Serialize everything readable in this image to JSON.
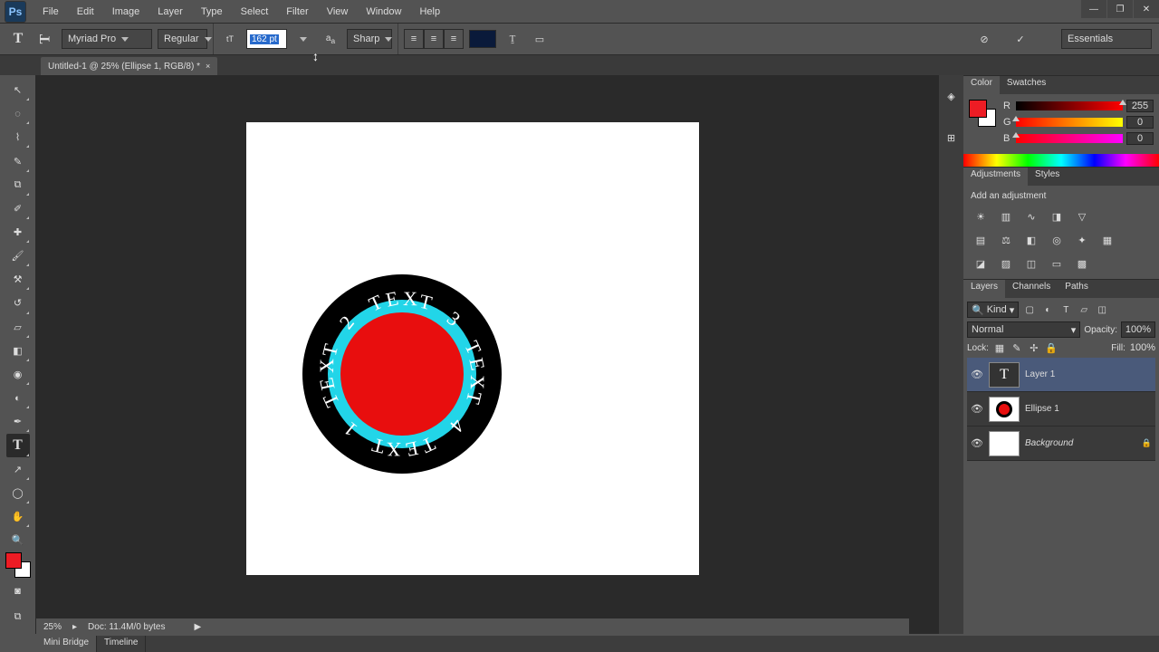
{
  "menu": [
    "File",
    "Edit",
    "Image",
    "Layer",
    "Type",
    "Select",
    "Filter",
    "View",
    "Window",
    "Help"
  ],
  "options": {
    "font": "Myriad Pro",
    "font_style": "Regular",
    "size": "162 pt",
    "aa": "Sharp",
    "workspace": "Essentials"
  },
  "tab": {
    "title": "Untitled-1 @ 25% (Ellipse 1, RGB/8) *"
  },
  "color_panel": {
    "tabs": [
      "Color",
      "Swatches"
    ],
    "r": 255,
    "g": 0,
    "b": 0
  },
  "adjustments_panel": {
    "tabs": [
      "Adjustments",
      "Styles"
    ],
    "label": "Add an adjustment"
  },
  "layers_panel": {
    "tabs": [
      "Layers",
      "Channels",
      "Paths"
    ],
    "kind": "Kind",
    "blend": "Normal",
    "opacity_label": "Opacity:",
    "opacity": "100%",
    "lock_label": "Lock:",
    "fill_label": "Fill:",
    "fill": "100%",
    "layers": [
      {
        "name": "Layer 1",
        "type": "text",
        "selected": true
      },
      {
        "name": "Ellipse 1",
        "type": "ellipse",
        "selected": false
      },
      {
        "name": "Background",
        "type": "bg",
        "selected": false,
        "locked": true,
        "italic": true
      }
    ]
  },
  "status": {
    "zoom": "25%",
    "doc": "Doc: 11.4M/0 bytes"
  },
  "bottom_tabs": [
    "Mini Bridge",
    "Timeline"
  ],
  "ring_text": "TEXT 1 TEXT 2 TEXT 3 TEXT 4 "
}
